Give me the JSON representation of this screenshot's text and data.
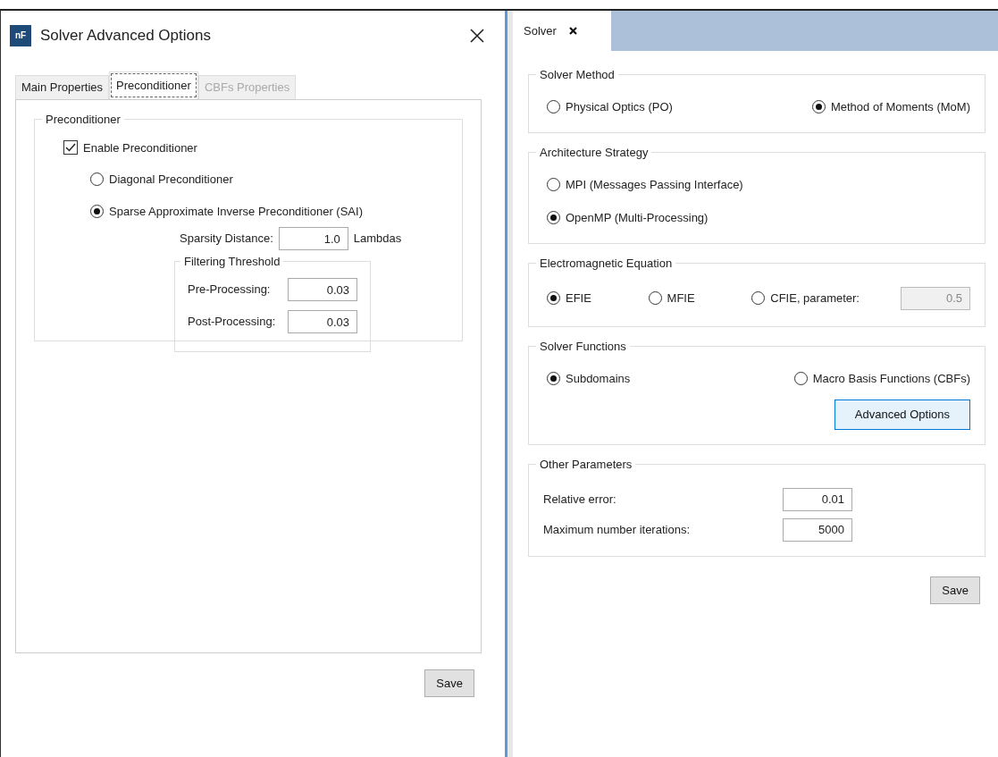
{
  "dialog": {
    "icon_text": "nF",
    "title": "Solver Advanced Options",
    "tabs": [
      {
        "label": "Main Properties",
        "selected": false,
        "disabled": false
      },
      {
        "label": "Preconditioner",
        "selected": true,
        "disabled": false
      },
      {
        "label": "CBFs Properties",
        "selected": false,
        "disabled": true
      }
    ],
    "group": {
      "title": "Preconditioner",
      "enable": {
        "label": "Enable Preconditioner",
        "checked": true
      },
      "options": [
        {
          "label": "Diagonal Preconditioner",
          "selected": false
        },
        {
          "label": "Sparse Approximate Inverse Preconditioner (SAI)",
          "selected": true
        }
      ],
      "sparsity": {
        "label": "Sparsity Distance:",
        "value": "1.0",
        "unit": "Lambdas"
      },
      "filtering": {
        "title": "Filtering Threshold",
        "fields": [
          {
            "label": "Pre-Processing:",
            "value": "0.03"
          },
          {
            "label": "Post-Processing:",
            "value": "0.03"
          }
        ]
      }
    },
    "save": "Save"
  },
  "solver": {
    "tab": "Solver",
    "groups": [
      {
        "title": "Solver Method",
        "kind": "row",
        "options": [
          {
            "label": "Physical Optics (PO)",
            "selected": false
          },
          {
            "label": "Method of Moments (MoM)",
            "selected": true
          }
        ]
      },
      {
        "title": "Architecture Strategy",
        "kind": "column",
        "options": [
          {
            "label": "MPI (Messages Passing Interface)",
            "selected": false
          },
          {
            "label": "OpenMP (Multi-Processing)",
            "selected": true
          }
        ]
      },
      {
        "title": "Electromagnetic Equation",
        "kind": "row",
        "options": [
          {
            "label": "EFIE",
            "selected": true
          },
          {
            "label": "MFIE",
            "selected": false
          },
          {
            "label": "CFIE, parameter:",
            "selected": false,
            "field": {
              "value": "0.5",
              "disabled": true
            }
          }
        ]
      },
      {
        "title": "Solver Functions",
        "kind": "row",
        "options": [
          {
            "label": "Subdomains",
            "selected": true
          },
          {
            "label": "Macro Basis Functions (CBFs)",
            "selected": false
          }
        ],
        "button": "Advanced Options"
      },
      {
        "title": "Other Parameters",
        "kind": "fields",
        "fields": [
          {
            "label": "Relative error:",
            "value": "0.01"
          },
          {
            "label": "Maximum number iterations:",
            "value": "5000"
          }
        ]
      }
    ],
    "save": "Save"
  }
}
